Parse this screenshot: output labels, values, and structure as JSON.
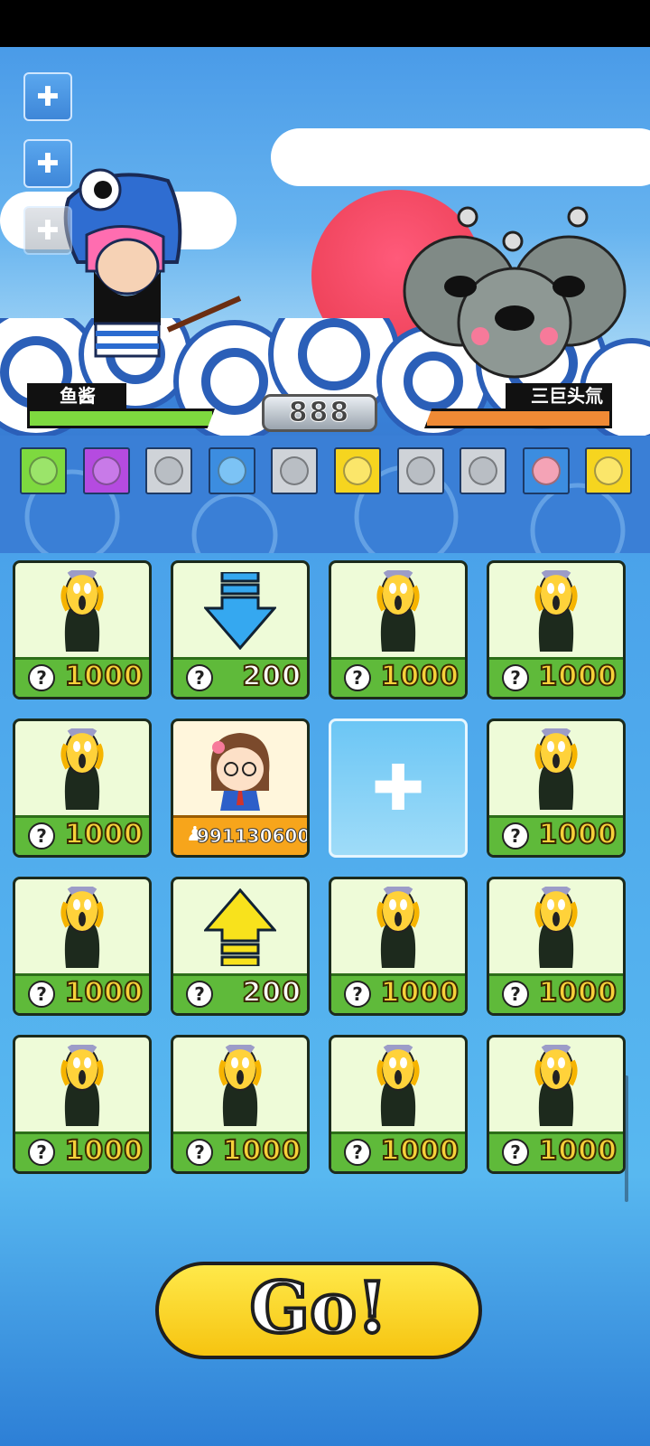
{
  "player": {
    "name": "鱼酱"
  },
  "enemy": {
    "name": "三巨头氚"
  },
  "score": "888",
  "colors": {
    "player_hp": "#7ed93f",
    "enemy_hp": "#f08a35",
    "card_footer": "#5fba3a",
    "self_footer": "#f7a51b",
    "go": "#f8d21c"
  },
  "items": [
    {
      "icon": "green-balloon-icon",
      "bg": "#7ed93f",
      "fill": "#9be46a"
    },
    {
      "icon": "purple-balloon-icon",
      "bg": "#b54be0",
      "fill": "#c87ae8"
    },
    {
      "icon": "gray-balloon-icon",
      "bg": "#cfd3d8",
      "fill": "#b9bec4"
    },
    {
      "icon": "blue-balloon-icon",
      "bg": "#3c8de0",
      "fill": "#7cc3f5"
    },
    {
      "icon": "gray-balloon-icon",
      "bg": "#cfd3d8",
      "fill": "#b9bec4"
    },
    {
      "icon": "yellow-balloon-icon",
      "bg": "#f6d51f",
      "fill": "#fbe66a"
    },
    {
      "icon": "gray-balloon-icon",
      "bg": "#cfd3d8",
      "fill": "#b9bec4"
    },
    {
      "icon": "gray-balloon-icon",
      "bg": "#cfd3d8",
      "fill": "#b9bec4"
    },
    {
      "icon": "piggy-bank-icon",
      "bg": "#3c8de0",
      "fill": "#f4a3b6"
    },
    {
      "icon": "yellow-balloon-icon",
      "bg": "#f6d51f",
      "fill": "#fbe66a"
    }
  ],
  "grid": [
    {
      "type": "mystery",
      "price": "1000"
    },
    {
      "type": "down-arrow",
      "price": "200"
    },
    {
      "type": "mystery",
      "price": "1000"
    },
    {
      "type": "mystery",
      "price": "1000"
    },
    {
      "type": "mystery",
      "price": "1000"
    },
    {
      "type": "self",
      "price": "991130600"
    },
    {
      "type": "add"
    },
    {
      "type": "mystery",
      "price": "1000"
    },
    {
      "type": "mystery",
      "price": "1000"
    },
    {
      "type": "up-arrow",
      "price": "200"
    },
    {
      "type": "mystery",
      "price": "1000"
    },
    {
      "type": "mystery",
      "price": "1000"
    },
    {
      "type": "mystery",
      "price": "1000"
    },
    {
      "type": "mystery",
      "price": "1000"
    },
    {
      "type": "mystery",
      "price": "1000"
    },
    {
      "type": "mystery",
      "price": "1000"
    }
  ],
  "question_mark": "?",
  "go_label": "Go!"
}
